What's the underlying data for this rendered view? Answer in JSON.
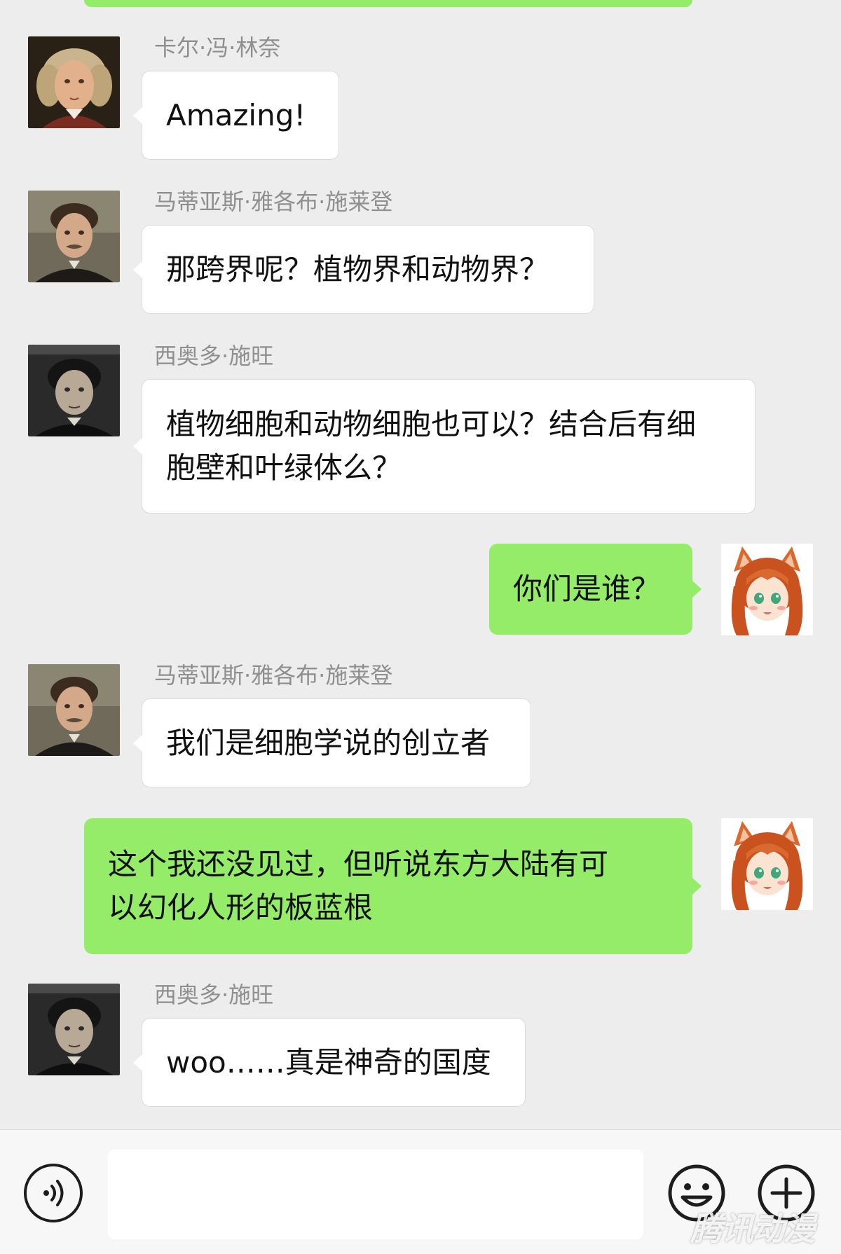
{
  "messages": [
    {
      "sender": "卡尔·冯·林奈",
      "side": "left",
      "avatar": "portrait-linnaeus-avatar",
      "lines": [
        "Amazing!"
      ]
    },
    {
      "sender": "马蒂亚斯·雅各布·施莱登",
      "side": "left",
      "avatar": "portrait-schleiden-avatar",
      "lines": [
        "那跨界呢？植物界和动物界？"
      ]
    },
    {
      "sender": "西奥多·施旺",
      "side": "left",
      "avatar": "portrait-schwann-avatar",
      "lines": [
        "植物细胞和动物细胞也可以？结合后有细",
        "胞壁和叶绿体么？"
      ]
    },
    {
      "sender": "",
      "side": "right",
      "avatar": "anime-girl-avatar",
      "lines": [
        "你们是谁？"
      ]
    },
    {
      "sender": "马蒂亚斯·雅各布·施莱登",
      "side": "left",
      "avatar": "portrait-schleiden-avatar",
      "lines": [
        "我们是细胞学说的创立者"
      ]
    },
    {
      "sender": "",
      "side": "right",
      "avatar": "anime-girl-avatar",
      "lines": [
        "这个我还没见过，但听说东方大陆有可",
        "以幻化人形的板蓝根"
      ]
    },
    {
      "sender": "西奥多·施旺",
      "side": "left",
      "avatar": "portrait-schwann-avatar",
      "lines": [
        "woo……真是神奇的国度"
      ]
    }
  ],
  "input_bar": {
    "voice_icon": "voice-icon",
    "emoji_icon": "smiley-face-icon",
    "plus_icon": "plus-circle-icon",
    "input_value": ""
  },
  "watermark": "腾讯动漫",
  "colors": {
    "background": "#ededed",
    "self_bubble": "#95ec69",
    "other_bubble": "#ffffff",
    "sender_name": "#8f8f8f"
  }
}
